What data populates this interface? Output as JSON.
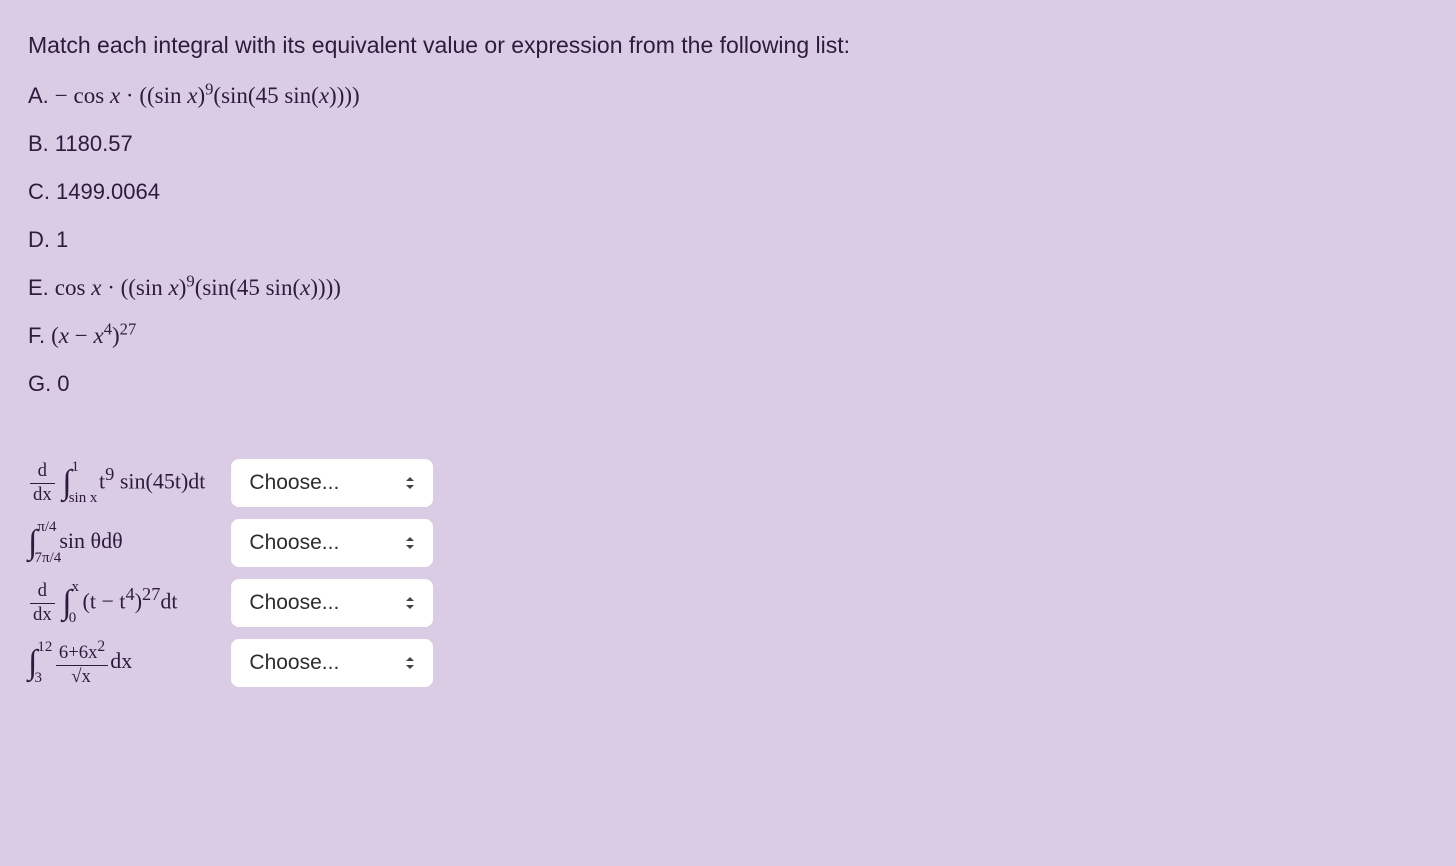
{
  "intro": "Match each integral with its equivalent value or expression from the following list:",
  "options": {
    "A": {
      "label": "A."
    },
    "B": {
      "label": "B.",
      "value": "1180.57"
    },
    "C": {
      "label": "C.",
      "value": "1499.0064"
    },
    "D": {
      "label": "D.",
      "value": "1"
    },
    "E": {
      "label": "E."
    },
    "F": {
      "label": "F."
    },
    "G": {
      "label": "G.",
      "value": "0"
    }
  },
  "dropdown": {
    "placeholder": "Choose...",
    "choices": [
      "A",
      "B",
      "C",
      "D",
      "E",
      "F",
      "G"
    ]
  },
  "chart_data": {
    "type": "table",
    "title": "Integral matching problem",
    "answer_options": [
      {
        "id": "A",
        "expression": "- cos x · ((sin x)^9 (sin(45 sin(x))))"
      },
      {
        "id": "B",
        "expression": "1180.57"
      },
      {
        "id": "C",
        "expression": "1499.0064"
      },
      {
        "id": "D",
        "expression": "1"
      },
      {
        "id": "E",
        "expression": "cos x · ((sin x)^9 (sin(45 sin(x))))"
      },
      {
        "id": "F",
        "expression": "(x - x^4)^27"
      },
      {
        "id": "G",
        "expression": "0"
      }
    ],
    "questions": [
      {
        "expression": "d/dx ∫_{sin x}^{1} t^9 sin(45t) dt",
        "selected": null
      },
      {
        "expression": "∫_{7π/4}^{π/4} sin θ dθ",
        "selected": null
      },
      {
        "expression": "d/dx ∫_{0}^{x} (t - t^4)^27 dt",
        "selected": null
      },
      {
        "expression": "∫_{3}^{12} (6 + 6x^2) / √x dx",
        "selected": null
      }
    ]
  }
}
